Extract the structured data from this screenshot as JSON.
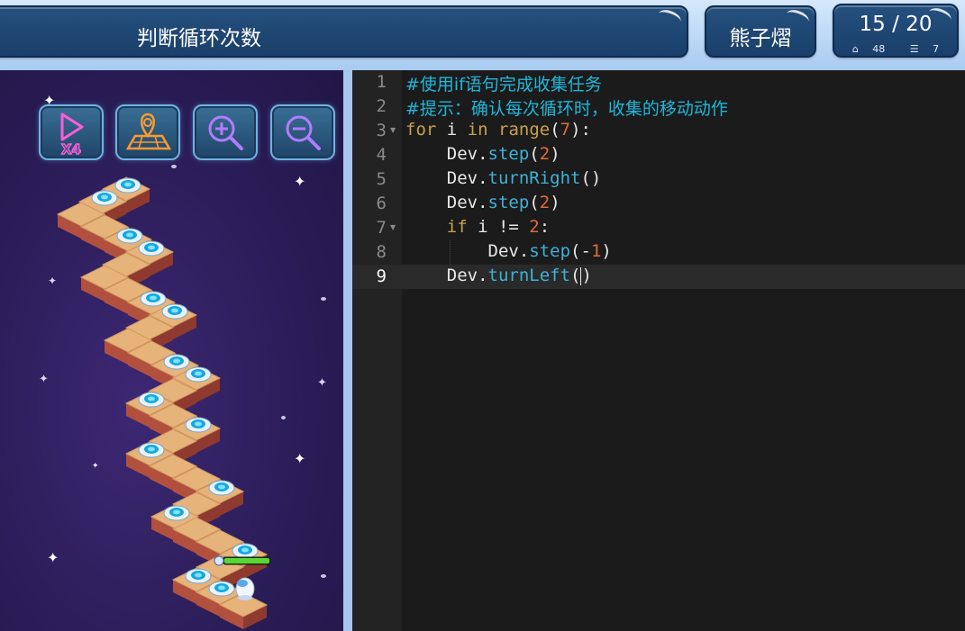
{
  "header": {
    "title": "判断循环次数",
    "user_name": "熊子熠",
    "level": "15 / 20",
    "stats": {
      "blocks_icon": "home-icon",
      "blocks": "48",
      "lines_icon": "list-icon",
      "lines": "7"
    }
  },
  "game": {
    "toolbar": [
      {
        "name": "speed-x4-button",
        "icon": "play-x4-icon",
        "label": "X4"
      },
      {
        "name": "map-pin-button",
        "icon": "map-pin-icon"
      },
      {
        "name": "zoom-in-button",
        "icon": "zoom-in-icon"
      },
      {
        "name": "zoom-out-button",
        "icon": "zoom-out-icon"
      }
    ],
    "robot_health": 1.0
  },
  "editor": {
    "lines": [
      {
        "n": "1",
        "text": "#使用if语句完成收集任务"
      },
      {
        "n": "2",
        "text": "#提示：确认每次循环时，收集的移动动作"
      },
      {
        "n": "3",
        "text": "for i in range(7):"
      },
      {
        "n": "4",
        "text": "    Dev.step(2)"
      },
      {
        "n": "5",
        "text": "    Dev.turnRight()"
      },
      {
        "n": "6",
        "text": "    Dev.step(2)"
      },
      {
        "n": "7",
        "text": "    if i != 2:"
      },
      {
        "n": "8",
        "text": "        Dev.step(-1)"
      },
      {
        "n": "9",
        "text": "    Dev.turnLeft()"
      }
    ]
  },
  "colors": {
    "comment": "#1fb6d9",
    "keyword": "#c7a24d",
    "function": "#3fb2d6",
    "number": "#e06a3a",
    "game_bg": "#2b1d58",
    "tile_top": "#e6b37b",
    "header_panel": "#1f4a77"
  }
}
